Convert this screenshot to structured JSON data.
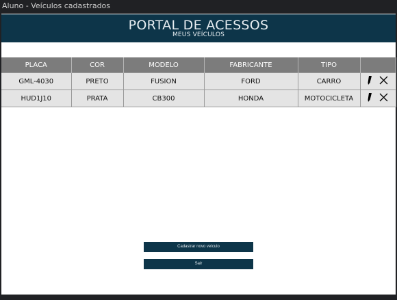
{
  "window": {
    "title": "Aluno - Veículos cadastrados"
  },
  "banner": {
    "title": "PORTAL DE ACESSOS",
    "subtitle": "MEUS VEÍCULOS"
  },
  "table": {
    "headers": [
      "PLACA",
      "COR",
      "MODELO",
      "FABRICANTE",
      "TIPO",
      ""
    ],
    "rows": [
      [
        "GML-4030",
        "PRETO",
        "FUSION",
        "FORD",
        "CARRO"
      ],
      [
        "HUD1J10",
        "PRATA",
        "CB300",
        "HONDA",
        "MOTOCICLETA"
      ]
    ],
    "row_actions": [
      "edit-pencil-icon",
      "delete-x-icon"
    ]
  },
  "buttons": {
    "add_vehicle": "Cadastrar novo veículo",
    "exit": "Sair"
  },
  "colors": {
    "brand": "#0d3549",
    "header_bg": "#7c7c7c",
    "row_bg": "#e4e4e4"
  }
}
